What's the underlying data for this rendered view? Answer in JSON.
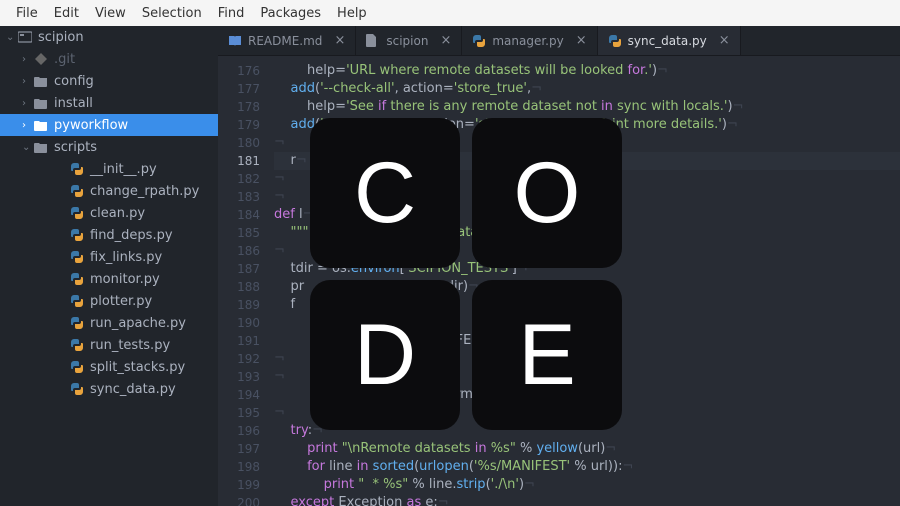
{
  "menubar": [
    "File",
    "Edit",
    "View",
    "Selection",
    "Find",
    "Packages",
    "Help"
  ],
  "project_root": "scipion",
  "tree": [
    {
      "depth": 0,
      "type": "root",
      "label": "scipion",
      "expanded": true
    },
    {
      "depth": 1,
      "type": "git",
      "label": ".git",
      "expanded": false,
      "dim": true
    },
    {
      "depth": 1,
      "type": "folder",
      "label": "config",
      "expanded": false
    },
    {
      "depth": 1,
      "type": "folder",
      "label": "install",
      "expanded": false
    },
    {
      "depth": 1,
      "type": "folder",
      "label": "pyworkflow",
      "expanded": false,
      "selected": true
    },
    {
      "depth": 1,
      "type": "folder",
      "label": "scripts",
      "expanded": true
    },
    {
      "depth": 2,
      "type": "py",
      "label": "__init__.py"
    },
    {
      "depth": 2,
      "type": "py",
      "label": "change_rpath.py"
    },
    {
      "depth": 2,
      "type": "py",
      "label": "clean.py"
    },
    {
      "depth": 2,
      "type": "py",
      "label": "find_deps.py"
    },
    {
      "depth": 2,
      "type": "py",
      "label": "fix_links.py"
    },
    {
      "depth": 2,
      "type": "py",
      "label": "monitor.py"
    },
    {
      "depth": 2,
      "type": "py",
      "label": "plotter.py"
    },
    {
      "depth": 2,
      "type": "py",
      "label": "run_apache.py"
    },
    {
      "depth": 2,
      "type": "py",
      "label": "run_tests.py"
    },
    {
      "depth": 2,
      "type": "py",
      "label": "split_stacks.py"
    },
    {
      "depth": 2,
      "type": "py",
      "label": "sync_data.py"
    }
  ],
  "tabs": [
    {
      "icon": "book",
      "label": "README.md",
      "active": false
    },
    {
      "icon": "file",
      "label": "scipion",
      "active": false
    },
    {
      "icon": "py",
      "label": "manager.py",
      "active": false
    },
    {
      "icon": "py",
      "label": "sync_data.py",
      "active": true
    }
  ],
  "code": {
    "start": 176,
    "current": 181,
    "rows": [
      "        help='URL where remote datasets will be looked for.')",
      "    add('--check-all', action='store_true',",
      "        help='See if there is any remote dataset not in sync with locals.')",
      "    add('-v', '--verbose', action='store_true', help='Print more details.')",
      "",
      "    r",
      "",
      "",
      "def l",
      "    \"\"\"                                    atasets \"\"\"",
      "",
      "    tdir = os.environ['SCIPION_TESTS']",
      "    pr              ets             (tdir)",
      "    f              ed(             ):",
      "                   di              ",
      "                   oi              MANIFEST')):",
      "",
      "",
      "                                   set format\") % folder",
      "",
      "    try:",
      "        print \"\\nRemote datasets in %s\" % yellow(url)",
      "        for line in sorted(urlopen('%s/MANIFEST' % url)):",
      "            print \"  * %s\" % line.strip('./\\n')",
      "    except Exception as e:"
    ]
  },
  "overlay_letters": [
    "C",
    "O",
    "D",
    "E"
  ]
}
